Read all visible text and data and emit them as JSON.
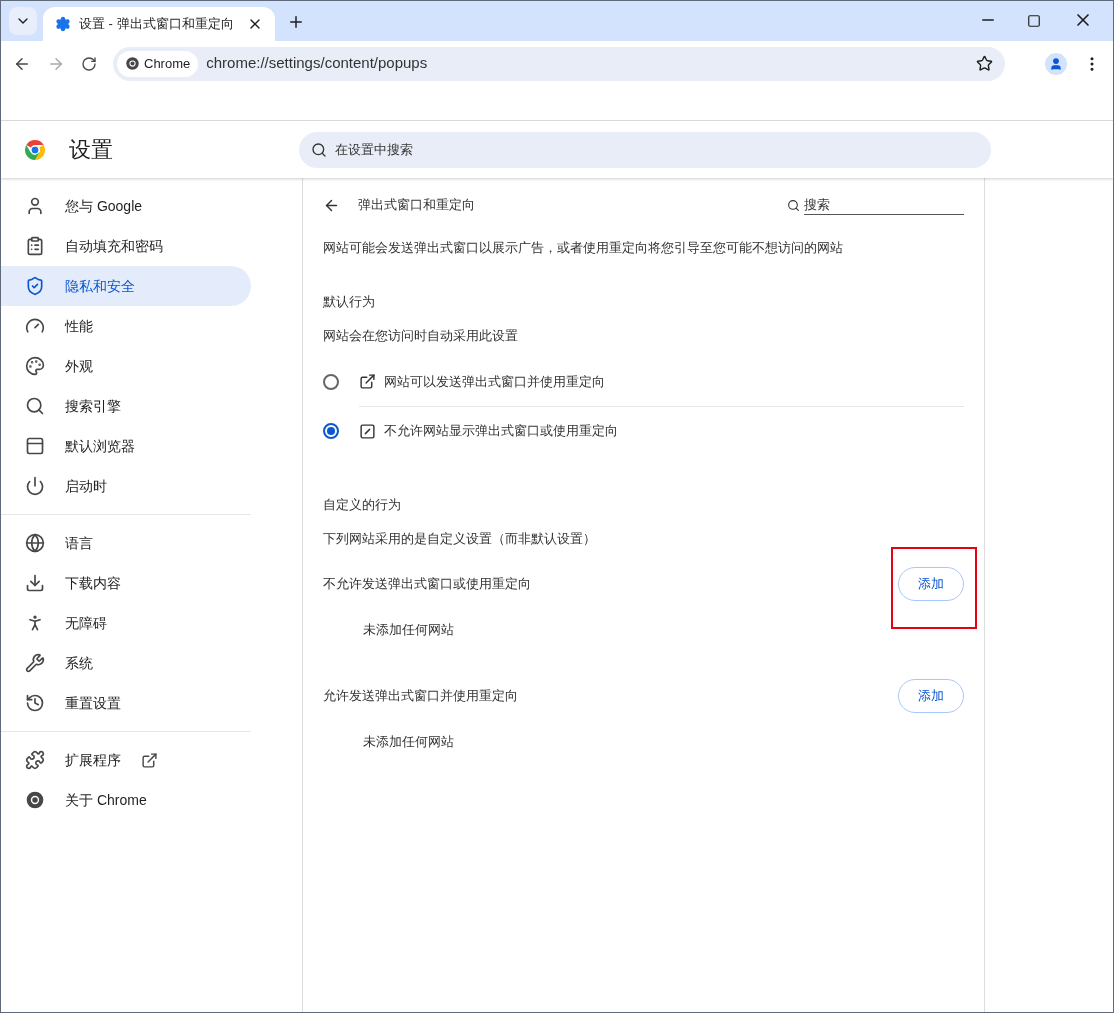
{
  "browser": {
    "tabs": [
      {
        "title": "设置 - 弹出式窗口和重定向",
        "selected": true
      }
    ],
    "address": {
      "chip": "Chrome",
      "url": "chrome://settings/content/popups"
    }
  },
  "header": {
    "title": "设置",
    "search": {
      "placeholder": "在设置中搜索"
    }
  },
  "sidebar": {
    "groups": [
      {
        "items": [
          {
            "label": "您与 Google",
            "selected": false
          },
          {
            "label": "自动填充和密码",
            "selected": false
          },
          {
            "label": "隐私和安全",
            "selected": true
          },
          {
            "label": "性能",
            "selected": false
          },
          {
            "label": "外观",
            "selected": false
          },
          {
            "label": "搜索引擎",
            "selected": false
          },
          {
            "label": "默认浏览器",
            "selected": false
          },
          {
            "label": "启动时",
            "selected": false
          }
        ]
      },
      {
        "items": [
          {
            "label": "语言",
            "selected": false
          },
          {
            "label": "下载内容",
            "selected": false
          },
          {
            "label": "无障碍",
            "selected": false
          },
          {
            "label": "系统",
            "selected": false
          },
          {
            "label": "重置设置",
            "selected": false
          }
        ]
      },
      {
        "items": [
          {
            "label": "扩展程序",
            "selected": false,
            "kind": "external"
          },
          {
            "label": "关于 Chrome",
            "selected": false,
            "kind": "page"
          }
        ]
      }
    ]
  },
  "page": {
    "title": "弹出式窗口和重定向",
    "search": {
      "placeholder": "搜索"
    },
    "description": "网站可能会发送弹出式窗口以展示广告，或者使用重定向将您引导至您可能不想访问的网站",
    "default_behavior": {
      "heading": "默认行为",
      "subtitle": "网站会在您访问时自动采用此设置",
      "options": [
        {
          "label": "网站可以发送弹出式窗口并使用重定向",
          "selected": false
        },
        {
          "label": "不允许网站显示弹出式窗口或使用重定向",
          "selected": true
        }
      ]
    },
    "custom_behavior": {
      "heading": "自定义的行为",
      "subtitle": "下列网站采用的是自定义设置（而非默认设置）",
      "lists": [
        {
          "title": "不允许发送弹出式窗口或使用重定向",
          "button": "添加",
          "empty": "未添加任何网站",
          "highlighted": true
        },
        {
          "title": "允许发送弹出式窗口并使用重定向",
          "button": "添加",
          "empty": "未添加任何网站",
          "highlighted": false
        }
      ]
    }
  }
}
